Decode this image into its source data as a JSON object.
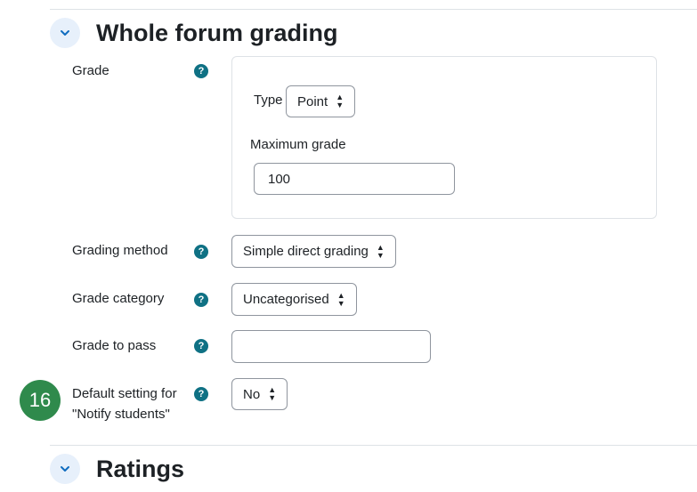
{
  "sections": {
    "whole_forum_grading": {
      "title": "Whole forum grading",
      "toggle_icon": "chevron-down-icon"
    },
    "ratings": {
      "title": "Ratings",
      "toggle_icon": "chevron-down-icon"
    }
  },
  "grade": {
    "label": "Grade",
    "type_label": "Type",
    "type_value": "Point",
    "max_grade_label": "Maximum grade",
    "max_grade_value": "100"
  },
  "grading_method": {
    "label": "Grading method",
    "value": "Simple direct grading"
  },
  "grade_category": {
    "label": "Grade category",
    "value": "Uncategorised"
  },
  "grade_to_pass": {
    "label": "Grade to pass",
    "value": ""
  },
  "notify_students": {
    "label_line1": "Default setting for",
    "label_line2": "\"Notify students\"",
    "value": "No"
  },
  "help_icon": {
    "glyph": "?"
  },
  "step_badge": "16",
  "colors": {
    "accent": "#0f6cbf",
    "help": "#0f7184",
    "badge": "#2f8a4c"
  }
}
